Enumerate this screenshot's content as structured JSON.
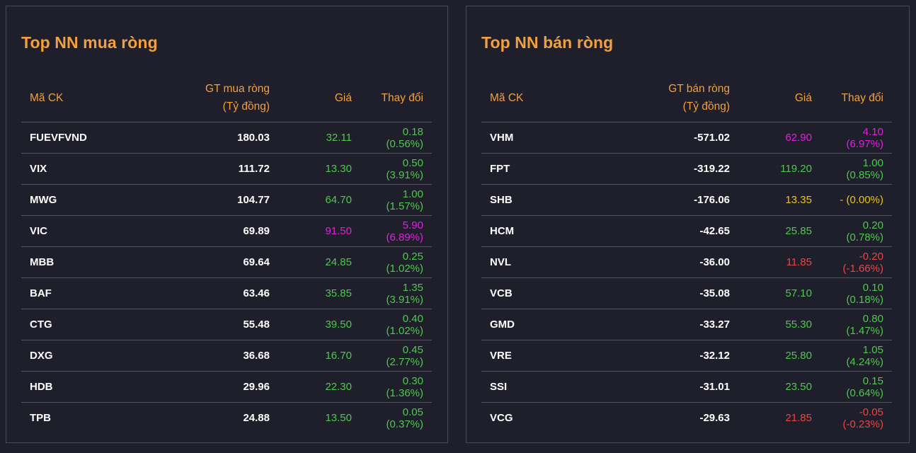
{
  "colors": {
    "title": "#f0a040",
    "background": "#1f1f2b",
    "border": "#4a4a57",
    "up": "#4cc94c",
    "ceiling": "#e020e0",
    "reference": "#e8c21a",
    "down": "#e84545"
  },
  "buy": {
    "title": "Top NN mua ròng",
    "headers": {
      "code": "Mã CK",
      "value_line1": "GT mua ròng",
      "value_line2": "(Tỷ đồng)",
      "price": "Giá",
      "change": "Thay đổi"
    },
    "rows": [
      {
        "code": "FUEVFVND",
        "value": "180.03",
        "price": "32.11",
        "change": "0.18 (0.56%)",
        "color": "green"
      },
      {
        "code": "VIX",
        "value": "111.72",
        "price": "13.30",
        "change": "0.50 (3.91%)",
        "color": "green"
      },
      {
        "code": "MWG",
        "value": "104.77",
        "price": "64.70",
        "change": "1.00 (1.57%)",
        "color": "green"
      },
      {
        "code": "VIC",
        "value": "69.89",
        "price": "91.50",
        "change": "5.90 (6.89%)",
        "color": "magenta"
      },
      {
        "code": "MBB",
        "value": "69.64",
        "price": "24.85",
        "change": "0.25 (1.02%)",
        "color": "green"
      },
      {
        "code": "BAF",
        "value": "63.46",
        "price": "35.85",
        "change": "1.35 (3.91%)",
        "color": "green"
      },
      {
        "code": "CTG",
        "value": "55.48",
        "price": "39.50",
        "change": "0.40 (1.02%)",
        "color": "green"
      },
      {
        "code": "DXG",
        "value": "36.68",
        "price": "16.70",
        "change": "0.45 (2.77%)",
        "color": "green"
      },
      {
        "code": "HDB",
        "value": "29.96",
        "price": "22.30",
        "change": "0.30 (1.36%)",
        "color": "green"
      },
      {
        "code": "TPB",
        "value": "24.88",
        "price": "13.50",
        "change": "0.05 (0.37%)",
        "color": "green"
      }
    ]
  },
  "sell": {
    "title": "Top NN bán ròng",
    "headers": {
      "code": "Mã CK",
      "value_line1": "GT bán ròng",
      "value_line2": "(Tỷ đồng)",
      "price": "Giá",
      "change": "Thay đổi"
    },
    "rows": [
      {
        "code": "VHM",
        "value": "-571.02",
        "price": "62.90",
        "change": "4.10 (6.97%)",
        "color": "magenta"
      },
      {
        "code": "FPT",
        "value": "-319.22",
        "price": "119.20",
        "change": "1.00 (0.85%)",
        "color": "green"
      },
      {
        "code": "SHB",
        "value": "-176.06",
        "price": "13.35",
        "change": "- (0.00%)",
        "color": "yellow"
      },
      {
        "code": "HCM",
        "value": "-42.65",
        "price": "25.85",
        "change": "0.20 (0.78%)",
        "color": "green"
      },
      {
        "code": "NVL",
        "value": "-36.00",
        "price": "11.85",
        "change": "-0.20 (-1.66%)",
        "color": "red"
      },
      {
        "code": "VCB",
        "value": "-35.08",
        "price": "57.10",
        "change": "0.10 (0.18%)",
        "color": "green"
      },
      {
        "code": "GMD",
        "value": "-33.27",
        "price": "55.30",
        "change": "0.80 (1.47%)",
        "color": "green"
      },
      {
        "code": "VRE",
        "value": "-32.12",
        "price": "25.80",
        "change": "1.05 (4.24%)",
        "color": "green"
      },
      {
        "code": "SSI",
        "value": "-31.01",
        "price": "23.50",
        "change": "0.15 (0.64%)",
        "color": "green"
      },
      {
        "code": "VCG",
        "value": "-29.63",
        "price": "21.85",
        "change": "-0.05 (-0.23%)",
        "color": "red"
      }
    ]
  }
}
